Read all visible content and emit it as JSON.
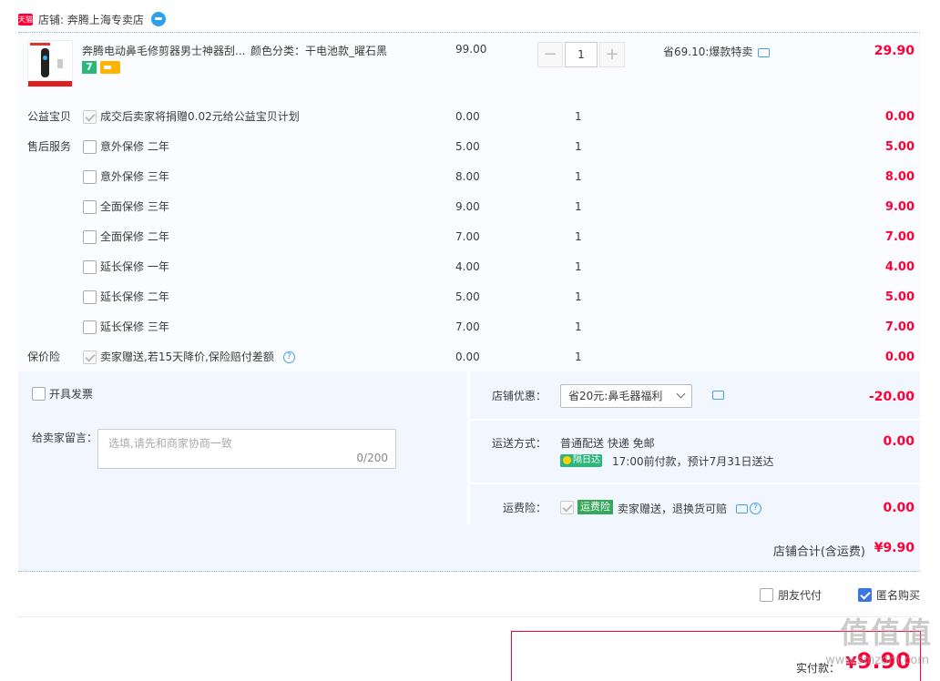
{
  "shop": {
    "tmall_logo": "天猫",
    "name": "店铺: 奔腾上海专卖店"
  },
  "product": {
    "title": "奔腾电动鼻毛修剪器男士神器刮...",
    "attr": "颜色分类：干电池款_曜石黑",
    "price": "99.00",
    "qty": "1",
    "promo": "省69.10:爆款特卖",
    "sum": "29.90",
    "tag_7": "7"
  },
  "rows": [
    {
      "label": "公益宝贝",
      "name": "成交后卖家将捐赠0.02元给公益宝贝计划",
      "price": "0.00",
      "qty": "1",
      "sum": "0.00",
      "checked": "gray"
    },
    {
      "label": "售后服务",
      "name": "意外保修 二年",
      "price": "5.00",
      "qty": "1",
      "sum": "5.00",
      "checked": "none"
    },
    {
      "label": "",
      "name": "意外保修 三年",
      "price": "8.00",
      "qty": "1",
      "sum": "8.00",
      "checked": "none"
    },
    {
      "label": "",
      "name": "全面保修 三年",
      "price": "9.00",
      "qty": "1",
      "sum": "9.00",
      "checked": "none"
    },
    {
      "label": "",
      "name": "全面保修 二年",
      "price": "7.00",
      "qty": "1",
      "sum": "7.00",
      "checked": "none"
    },
    {
      "label": "",
      "name": "延长保修 一年",
      "price": "4.00",
      "qty": "1",
      "sum": "4.00",
      "checked": "none"
    },
    {
      "label": "",
      "name": "延长保修 二年",
      "price": "5.00",
      "qty": "1",
      "sum": "5.00",
      "checked": "none"
    },
    {
      "label": "",
      "name": "延长保修 三年",
      "price": "7.00",
      "qty": "1",
      "sum": "7.00",
      "checked": "none"
    },
    {
      "label": "保价险",
      "name": "卖家赠送,若15天降价,保险赔付差额",
      "price": "0.00",
      "qty": "1",
      "sum": "0.00",
      "checked": "gray"
    }
  ],
  "invoice": {
    "label": "开具发票"
  },
  "message": {
    "label": "给卖家留言：",
    "placeholder": "选填,请先和商家协商一致",
    "count": "0/200"
  },
  "discount": {
    "label": "店铺优惠：",
    "selected": "省20元:鼻毛器福利",
    "amount": "-20.00"
  },
  "shipping": {
    "label": "运送方式：",
    "main": "普通配送 快递 免邮",
    "tag": "隔日达",
    "sub": "17:00前付款，预计7月31日送达",
    "amount": "0.00"
  },
  "insurance": {
    "label": "运费险：",
    "tag": "运费险",
    "text": "卖家赠送，退换货可赔",
    "amount": "0.00"
  },
  "total": {
    "label": "店铺合计(含运费)",
    "amount": "¥9.90"
  },
  "options": {
    "friend_pay": "朋友代付",
    "anonymous": "匿名购买"
  },
  "pay": {
    "label": "实付款：",
    "currency": "¥",
    "amount": "9.90"
  },
  "watermark": {
    "text": "值值值",
    "url": "www.smzdm.com"
  }
}
